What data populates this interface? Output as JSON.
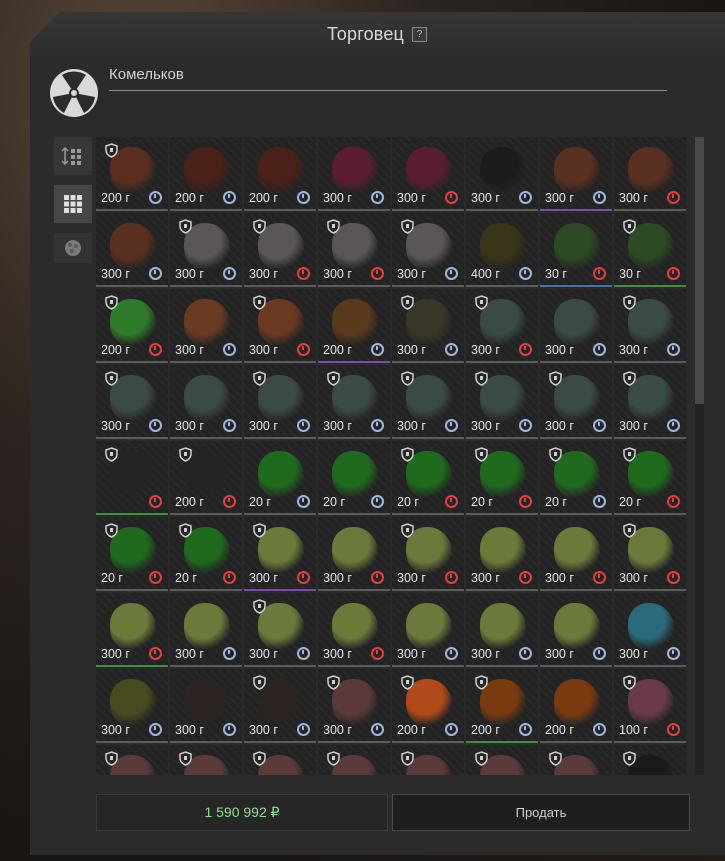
{
  "window": {
    "title": "Торговец",
    "help_label": "?"
  },
  "trader": {
    "name": "Комельков"
  },
  "footer": {
    "balance": "1 590 992 ₽",
    "sell_label": "Продать"
  },
  "colors": {
    "price_text": "#e8e8e8",
    "balance": "#8ee08e",
    "timer_blue": "#9fb7e0",
    "timer_red": "#e04040"
  },
  "items": [
    {
      "price": "200 г",
      "timer": "blue",
      "shield": true,
      "art": "#5a2e20",
      "rarity": "none"
    },
    {
      "price": "200 г",
      "timer": "blue",
      "shield": false,
      "art": "#4a2018",
      "rarity": "none"
    },
    {
      "price": "200 г",
      "timer": "blue",
      "shield": false,
      "art": "#4a2018",
      "rarity": "none"
    },
    {
      "price": "300 г",
      "timer": "blue",
      "shield": false,
      "art": "#5a1e30",
      "rarity": "none"
    },
    {
      "price": "300 г",
      "timer": "red",
      "shield": false,
      "art": "#5a1e30",
      "rarity": "none"
    },
    {
      "price": "300 г",
      "timer": "blue",
      "shield": false,
      "art": "#1c1c1c",
      "rarity": "none"
    },
    {
      "price": "300 г",
      "timer": "blue",
      "shield": false,
      "art": "#5a3020",
      "rarity": "purple"
    },
    {
      "price": "300 г",
      "timer": "red",
      "shield": false,
      "art": "#5a3020",
      "rarity": "none"
    },
    {
      "price": "300 г",
      "timer": "blue",
      "shield": false,
      "art": "#5a3020",
      "rarity": "none"
    },
    {
      "price": "300 г",
      "timer": "blue",
      "shield": true,
      "art": "#5a5558",
      "rarity": "none"
    },
    {
      "price": "300 г",
      "timer": "red",
      "shield": true,
      "art": "#5a5558",
      "rarity": "none"
    },
    {
      "price": "300 г",
      "timer": "red",
      "shield": true,
      "art": "#5a5558",
      "rarity": "none"
    },
    {
      "price": "300 г",
      "timer": "blue",
      "shield": true,
      "art": "#5a5558",
      "rarity": "none"
    },
    {
      "price": "400 г",
      "timer": "blue",
      "shield": false,
      "art": "#3a3418",
      "rarity": "none"
    },
    {
      "price": "30 г",
      "timer": "red",
      "shield": false,
      "art": "#2c4a24",
      "rarity": "blue"
    },
    {
      "price": "30 г",
      "timer": "red",
      "shield": true,
      "art": "#2c4a24",
      "rarity": "green"
    },
    {
      "price": "200 г",
      "timer": "red",
      "shield": true,
      "art": "#2f7a2a",
      "rarity": "none"
    },
    {
      "price": "300 г",
      "timer": "blue",
      "shield": false,
      "art": "#6a3a22",
      "rarity": "none"
    },
    {
      "price": "300 г",
      "timer": "red",
      "shield": true,
      "art": "#6a3a22",
      "rarity": "none"
    },
    {
      "price": "200 г",
      "timer": "blue",
      "shield": false,
      "art": "#5a3a1c",
      "rarity": "purple"
    },
    {
      "price": "300 г",
      "timer": "blue",
      "shield": true,
      "art": "#3a3628",
      "rarity": "none"
    },
    {
      "price": "300 г",
      "timer": "red",
      "shield": true,
      "art": "#3a4a44",
      "rarity": "none"
    },
    {
      "price": "300 г",
      "timer": "blue",
      "shield": false,
      "art": "#3a4a44",
      "rarity": "none"
    },
    {
      "price": "300 г",
      "timer": "blue",
      "shield": true,
      "art": "#3a4a44",
      "rarity": "none"
    },
    {
      "price": "300 г",
      "timer": "blue",
      "shield": true,
      "art": "#3a4a44",
      "rarity": "none"
    },
    {
      "price": "300 г",
      "timer": "blue",
      "shield": false,
      "art": "#3a4a44",
      "rarity": "none"
    },
    {
      "price": "300 г",
      "timer": "blue",
      "shield": true,
      "art": "#3a4a44",
      "rarity": "none"
    },
    {
      "price": "300 г",
      "timer": "blue",
      "shield": true,
      "art": "#3a4a44",
      "rarity": "none"
    },
    {
      "price": "300 г",
      "timer": "blue",
      "shield": true,
      "art": "#3a4a44",
      "rarity": "none"
    },
    {
      "price": "300 г",
      "timer": "blue",
      "shield": true,
      "art": "#3a4a44",
      "rarity": "none"
    },
    {
      "price": "300 г",
      "timer": "blue",
      "shield": true,
      "art": "#3a4a44",
      "rarity": "none"
    },
    {
      "price": "300 г",
      "timer": "blue",
      "shield": true,
      "art": "#3a4a44",
      "rarity": "none"
    },
    {
      "price": "",
      "timer": "red",
      "shield": true,
      "art": "#242424",
      "rarity": "green"
    },
    {
      "price": "200 г",
      "timer": "red",
      "shield": true,
      "art": "#242424",
      "rarity": "none"
    },
    {
      "price": "20 г",
      "timer": "blue",
      "shield": false,
      "art": "#1f6a1f",
      "rarity": "none"
    },
    {
      "price": "20 г",
      "timer": "blue",
      "shield": false,
      "art": "#1f6a1f",
      "rarity": "none"
    },
    {
      "price": "20 г",
      "timer": "red",
      "shield": true,
      "art": "#1f6a1f",
      "rarity": "none"
    },
    {
      "price": "20 г",
      "timer": "red",
      "shield": true,
      "art": "#1f6a1f",
      "rarity": "none"
    },
    {
      "price": "20 г",
      "timer": "blue",
      "shield": true,
      "art": "#1f6a1f",
      "rarity": "none"
    },
    {
      "price": "20 г",
      "timer": "red",
      "shield": true,
      "art": "#1f6a1f",
      "rarity": "none"
    },
    {
      "price": "20 г",
      "timer": "red",
      "shield": true,
      "art": "#1f6a1f",
      "rarity": "none"
    },
    {
      "price": "20 г",
      "timer": "red",
      "shield": true,
      "art": "#1f6a1f",
      "rarity": "none"
    },
    {
      "price": "300 г",
      "timer": "red",
      "shield": true,
      "art": "#6a7a3a",
      "rarity": "purple"
    },
    {
      "price": "300 г",
      "timer": "red",
      "shield": false,
      "art": "#6a7a3a",
      "rarity": "none"
    },
    {
      "price": "300 г",
      "timer": "red",
      "shield": true,
      "art": "#6a7a3a",
      "rarity": "none"
    },
    {
      "price": "300 г",
      "timer": "red",
      "shield": false,
      "art": "#6a7a3a",
      "rarity": "none"
    },
    {
      "price": "300 г",
      "timer": "red",
      "shield": false,
      "art": "#6a7a3a",
      "rarity": "none"
    },
    {
      "price": "300 г",
      "timer": "red",
      "shield": true,
      "art": "#6a7a3a",
      "rarity": "none"
    },
    {
      "price": "300 г",
      "timer": "red",
      "shield": false,
      "art": "#6a7a3a",
      "rarity": "green"
    },
    {
      "price": "300 г",
      "timer": "blue",
      "shield": false,
      "art": "#6a7a3a",
      "rarity": "none"
    },
    {
      "price": "300 г",
      "timer": "blue",
      "shield": true,
      "art": "#6a7a3a",
      "rarity": "none"
    },
    {
      "price": "300 г",
      "timer": "red",
      "shield": false,
      "art": "#6a7a3a",
      "rarity": "none"
    },
    {
      "price": "300 г",
      "timer": "blue",
      "shield": false,
      "art": "#6a7a3a",
      "rarity": "none"
    },
    {
      "price": "300 г",
      "timer": "blue",
      "shield": false,
      "art": "#6a7a3a",
      "rarity": "none"
    },
    {
      "price": "300 г",
      "timer": "blue",
      "shield": false,
      "art": "#6a7a3a",
      "rarity": "none"
    },
    {
      "price": "300 г",
      "timer": "blue",
      "shield": false,
      "art": "#2a6a7a",
      "rarity": "none"
    },
    {
      "price": "300 г",
      "timer": "blue",
      "shield": false,
      "art": "#4a4a20",
      "rarity": "none"
    },
    {
      "price": "300 г",
      "timer": "blue",
      "shield": false,
      "art": "#2c2420",
      "rarity": "none"
    },
    {
      "price": "300 г",
      "timer": "blue",
      "shield": true,
      "art": "#2c2420",
      "rarity": "none"
    },
    {
      "price": "300 г",
      "timer": "blue",
      "shield": true,
      "art": "#5a3a3a",
      "rarity": "none"
    },
    {
      "price": "200 г",
      "timer": "blue",
      "shield": true,
      "art": "#b04a1a",
      "rarity": "none"
    },
    {
      "price": "200 г",
      "timer": "blue",
      "shield": true,
      "art": "#7a3a10",
      "rarity": "green"
    },
    {
      "price": "200 г",
      "timer": "blue",
      "shield": false,
      "art": "#7a3a10",
      "rarity": "none"
    },
    {
      "price": "100 г",
      "timer": "red",
      "shield": true,
      "art": "#6a3a4a",
      "rarity": "none"
    },
    {
      "price": "",
      "timer": "none",
      "shield": true,
      "art": "#5a3a3a",
      "rarity": "none"
    },
    {
      "price": "",
      "timer": "none",
      "shield": true,
      "art": "#5a3a3a",
      "rarity": "none"
    },
    {
      "price": "",
      "timer": "none",
      "shield": true,
      "art": "#5a3a3a",
      "rarity": "none"
    },
    {
      "price": "",
      "timer": "none",
      "shield": true,
      "art": "#5a3a3a",
      "rarity": "none"
    },
    {
      "price": "",
      "timer": "none",
      "shield": true,
      "art": "#5a3a3a",
      "rarity": "none"
    },
    {
      "price": "",
      "timer": "none",
      "shield": true,
      "art": "#5a3a3a",
      "rarity": "none"
    },
    {
      "price": "",
      "timer": "none",
      "shield": true,
      "art": "#5a3a3a",
      "rarity": "none"
    },
    {
      "price": "",
      "timer": "none",
      "shield": true,
      "art": "#1a1a1a",
      "rarity": "none"
    }
  ]
}
